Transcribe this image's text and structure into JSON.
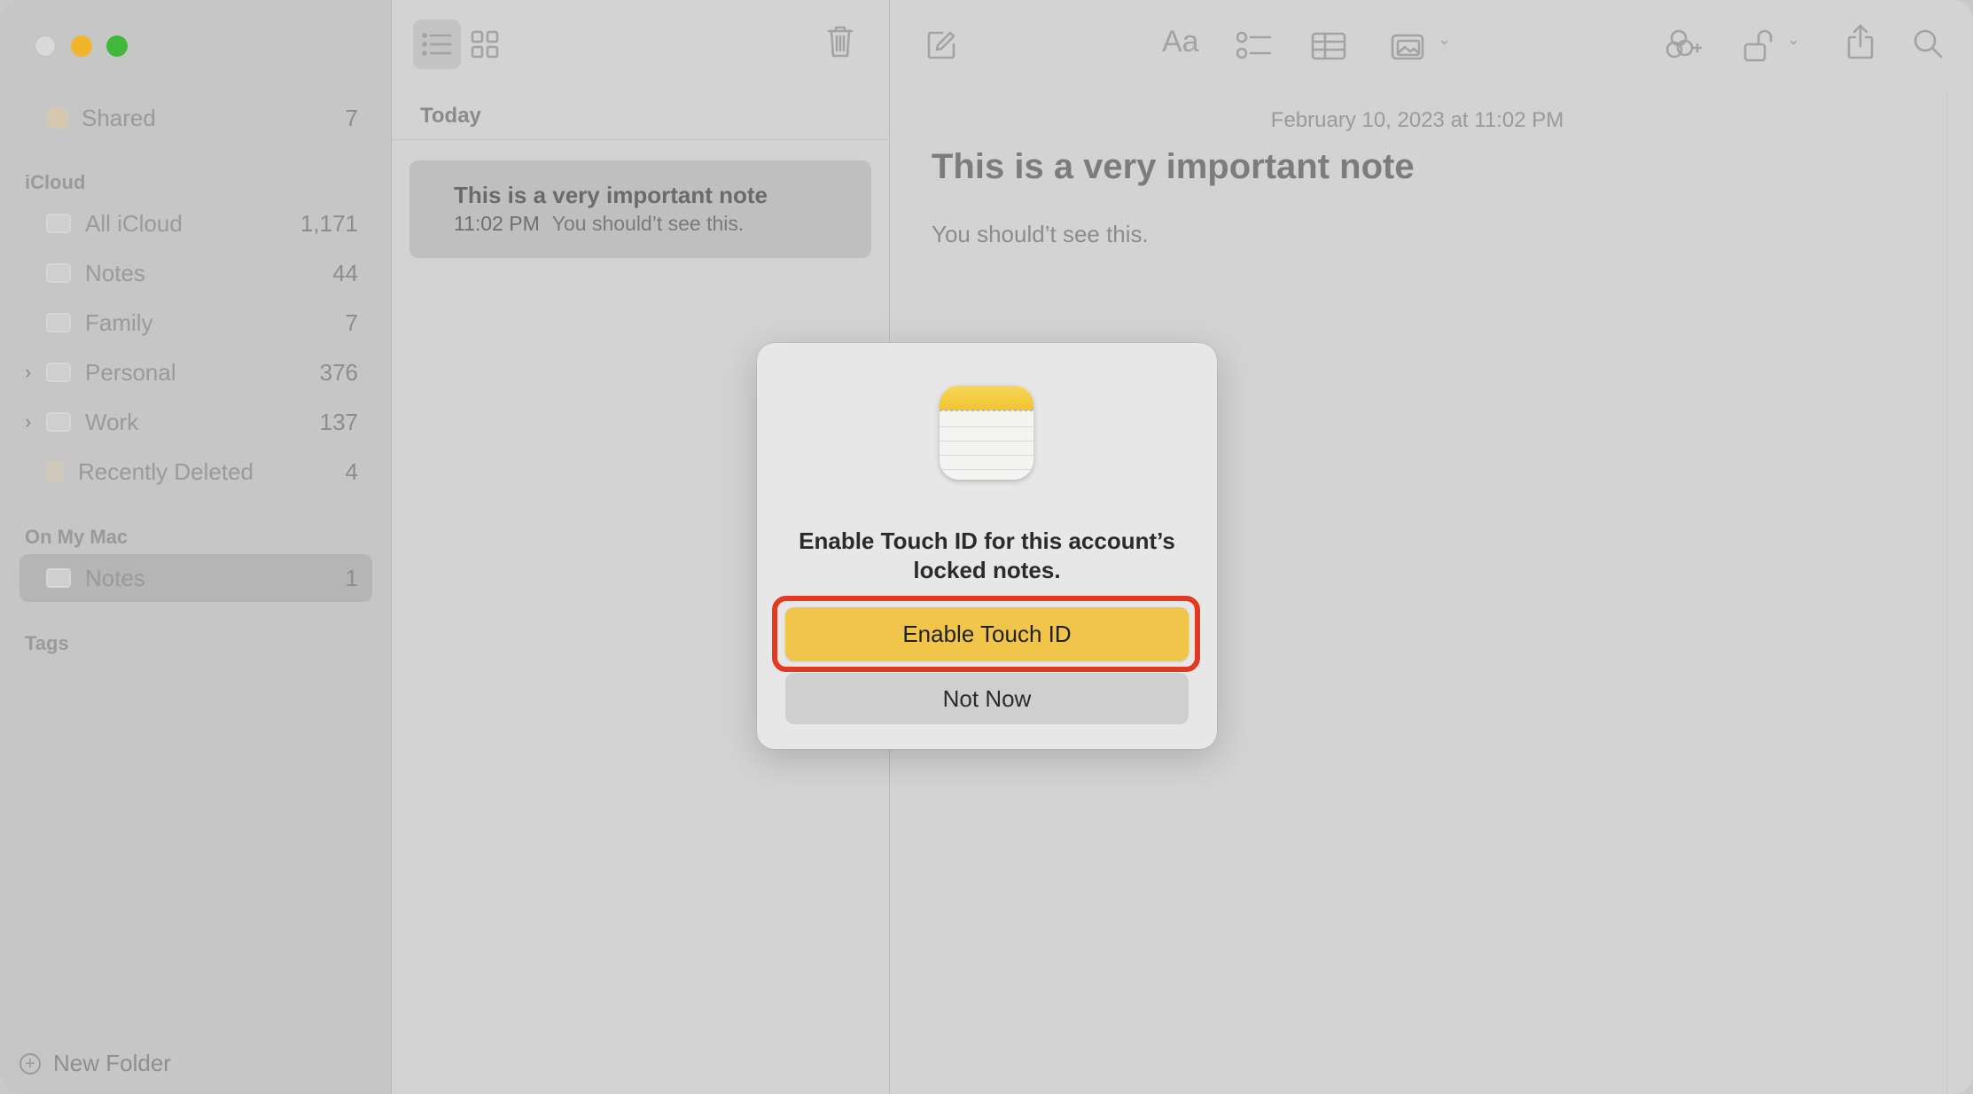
{
  "sidebar": {
    "shared": {
      "label": "Shared",
      "count": "7"
    },
    "icloud_header": "iCloud",
    "icloud_items": [
      {
        "label": "All iCloud",
        "count": "1,171"
      },
      {
        "label": "Notes",
        "count": "44"
      },
      {
        "label": "Family",
        "count": "7"
      },
      {
        "label": "Personal",
        "count": "376"
      },
      {
        "label": "Work",
        "count": "137"
      },
      {
        "label": "Recently Deleted",
        "count": "4"
      }
    ],
    "mac_header": "On My Mac",
    "mac_items": [
      {
        "label": "Notes",
        "count": "1"
      }
    ],
    "tags_header": "Tags",
    "new_folder": "New Folder"
  },
  "notelist": {
    "section": "Today",
    "notes": [
      {
        "title": "This is a very important note",
        "time": "11:02 PM",
        "preview": "You should’t see this."
      }
    ]
  },
  "editor": {
    "date": "February 10, 2023 at 11:02 PM",
    "title": "This is a very important note",
    "body": "You should’t see this.",
    "format_label": "Aa"
  },
  "dialog": {
    "message": "Enable Touch ID for this account’s locked notes.",
    "primary": "Enable Touch ID",
    "secondary": "Not Now"
  },
  "colors": {
    "accent": "#F0C54A",
    "highlight": "#E23A22"
  }
}
